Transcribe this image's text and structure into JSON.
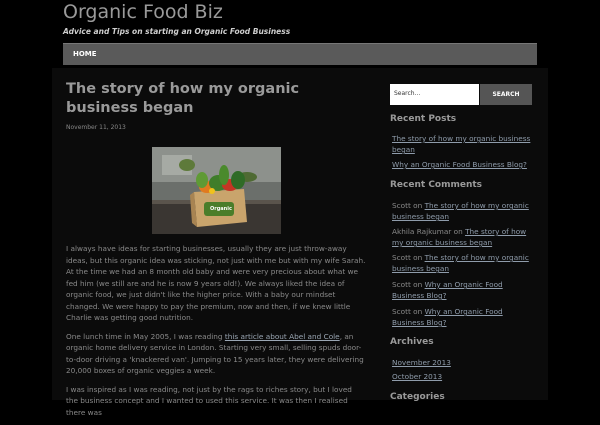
{
  "site": {
    "title": "Organic Food Biz",
    "tagline": "Advice and Tips on starting an Organic Food Business"
  },
  "nav": {
    "home": "HOME"
  },
  "post": {
    "title": "The story of how my organic business began",
    "date": "November 11, 2013",
    "image_logo": "Organic",
    "p1": "I always have ideas for starting businesses, usually they are just throw-away ideas, but this organic idea was sticking, not just with me but with my wife Sarah. At the time we had an 8 month old baby and were very precious about what we fed him (we still are and he is now 9 years old!). We always liked the idea of organic food, we just didn't like the higher price. With a baby our mindset changed. We were happy to pay the premium, now and then, if we knew little Charlie was getting good nutrition.",
    "p2_before": "One lunch time in May 2005, I was reading ",
    "p2_link": "this article  about Abel and Cole",
    "p2_after": ", an organic home delivery service in London. Starting very small, selling spuds door-to-door driving a 'knackered van'. Jumping to 15 years later, they were delivering 20,000 boxes of organic veggies a week.",
    "p3": "I was inspired as I was reading, not just by the rags to riches story, but I loved the business concept and I wanted to used this service. It was then I realised there was"
  },
  "sidebar": {
    "search_placeholder": "Search...",
    "search_button": "SEARCH",
    "recent_posts_title": "Recent Posts",
    "recent_posts": [
      "The story of how my organic business began",
      "Why an Organic Food Business Blog?"
    ],
    "recent_comments_title": "Recent Comments",
    "comments": [
      {
        "author": "Scott",
        "on": "on",
        "post": "The story of how my organic business began"
      },
      {
        "author": "Akhila Rajkumar",
        "on": "on",
        "post": "The story of how my organic business began"
      },
      {
        "author": "Scott",
        "on": "on",
        "post": "The story of how my organic business began"
      },
      {
        "author": "Scott",
        "on": "on",
        "post": "Why an Organic Food Business Blog?"
      },
      {
        "author": "Scott",
        "on": "on",
        "post": "Why an Organic Food Business Blog?"
      }
    ],
    "archives_title": "Archives",
    "archives": [
      "November 2013",
      "October 2013"
    ],
    "categories_title": "Categories"
  }
}
